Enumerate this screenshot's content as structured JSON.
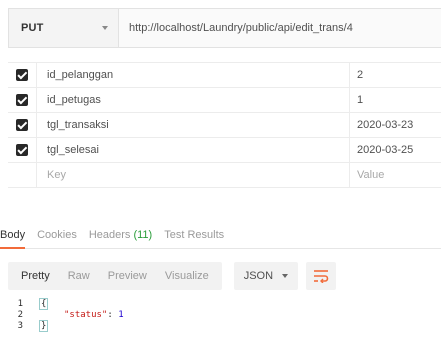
{
  "request": {
    "method": "PUT",
    "url": "http://localhost/Laundry/public/api/edit_trans/4"
  },
  "params": [
    {
      "key": "id_pelanggan",
      "value": "2",
      "checked": true
    },
    {
      "key": "id_petugas",
      "value": "1",
      "checked": true
    },
    {
      "key": "tgl_transaksi",
      "value": "2020-03-23",
      "checked": true
    },
    {
      "key": "tgl_selesai",
      "value": "2020-03-25",
      "checked": true
    }
  ],
  "params_placeholder": {
    "key": "Key",
    "value": "Value"
  },
  "response_tabs": {
    "body": "Body",
    "cookies": "Cookies",
    "headers_label": "Headers",
    "headers_count": "(11)",
    "test_results": "Test Results"
  },
  "view_modes": {
    "pretty": "Pretty",
    "raw": "Raw",
    "preview": "Preview",
    "visualize": "Visualize"
  },
  "format_select": "JSON",
  "code": {
    "line_numbers": [
      "1",
      "2",
      "3"
    ],
    "open_brace": "{",
    "key": "\"status\"",
    "colon": ":",
    "value": "1",
    "close_brace": "}"
  },
  "colors": {
    "accent": "#f26b3a",
    "count_green": "#2a9d3a",
    "json_key": "#c41a16",
    "json_number": "#1c00cf"
  }
}
